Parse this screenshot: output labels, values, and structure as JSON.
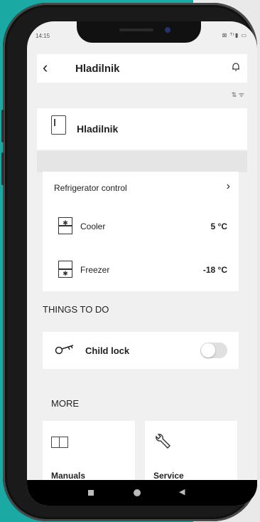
{
  "status_bar": {
    "time": "14:15",
    "sys_icons": "⊠ ᵀᵗ▮ ▭"
  },
  "header": {
    "back_icon": "‹",
    "title": "Hladilnik",
    "bell_icon": "🔔"
  },
  "connectivity": "⇅ ᯤ",
  "device": {
    "name": "Hladilnik"
  },
  "refrigerator_control": {
    "title": "Refrigerator control",
    "chevron": "›",
    "rows": [
      {
        "label": "Cooler",
        "value": "5 °C"
      },
      {
        "label": "Freezer",
        "value": "-18 °C"
      }
    ]
  },
  "things_to_do": {
    "heading": "THINGS TO DO",
    "child_lock": {
      "label": "Child lock",
      "enabled": false
    }
  },
  "more": {
    "heading": "MORE",
    "tiles": [
      {
        "label": "Manuals",
        "icon": "book-icon"
      },
      {
        "label": "Service",
        "icon": "wrench-icon"
      }
    ]
  },
  "colors": {
    "background_teal": "#1ba9a4",
    "card": "#ffffff",
    "screen_bg": "#f0f0f0"
  }
}
